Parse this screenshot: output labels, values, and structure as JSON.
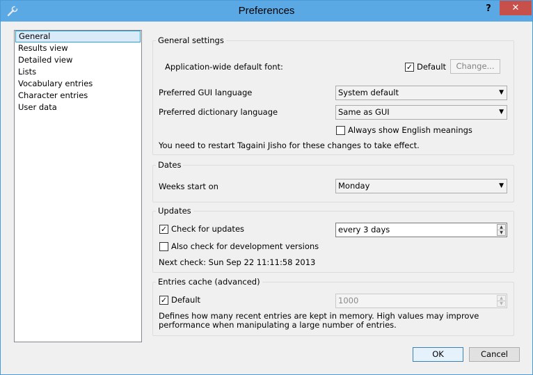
{
  "window": {
    "title": "Preferences",
    "help_label": "?",
    "close_label": "✕",
    "app_icon": "wrench-icon"
  },
  "sidebar": {
    "items": [
      {
        "label": "General",
        "selected": true
      },
      {
        "label": "Results view"
      },
      {
        "label": "Detailed view"
      },
      {
        "label": "Lists"
      },
      {
        "label": "Vocabulary entries"
      },
      {
        "label": "Character entries"
      },
      {
        "label": "User data"
      }
    ]
  },
  "general": {
    "title": "General settings",
    "font_label": "Application-wide default font:",
    "font_default_checked": true,
    "font_default_label": "Default",
    "change_label": "Change...",
    "gui_lang_label": "Preferred GUI language",
    "gui_lang_value": "System default",
    "dict_lang_label": "Preferred dictionary language",
    "dict_lang_value": "Same as GUI",
    "always_english_checked": false,
    "always_english_label": "Always show English meanings",
    "restart_note": "You need to restart Tagaini Jisho for these changes to take effect."
  },
  "dates": {
    "title": "Dates",
    "weeks_label": "Weeks start on",
    "weeks_value": "Monday"
  },
  "updates": {
    "title": "Updates",
    "check_checked": true,
    "check_label": "Check for updates",
    "interval_value": "every 3 days",
    "dev_checked": false,
    "dev_label": "Also check for development versions",
    "next_check": "Next check: Sun Sep 22 11:11:58 2013"
  },
  "cache": {
    "title": "Entries cache (advanced)",
    "default_checked": true,
    "default_label": "Default",
    "size_value": "1000",
    "description": "Defines how many recent entries are kept in memory. High values may improve performance when manipulating a large number of entries."
  },
  "buttons": {
    "ok_label": "OK",
    "cancel_label": "Cancel"
  },
  "icons": {
    "checked_glyph": "✓",
    "dropdown_glyph": "▼",
    "spin_up_glyph": "▲",
    "spin_down_glyph": "▼"
  },
  "colors": {
    "titlebar": "#5aa9e4",
    "close": "#c7504a",
    "selection": "#d9ebf9"
  }
}
